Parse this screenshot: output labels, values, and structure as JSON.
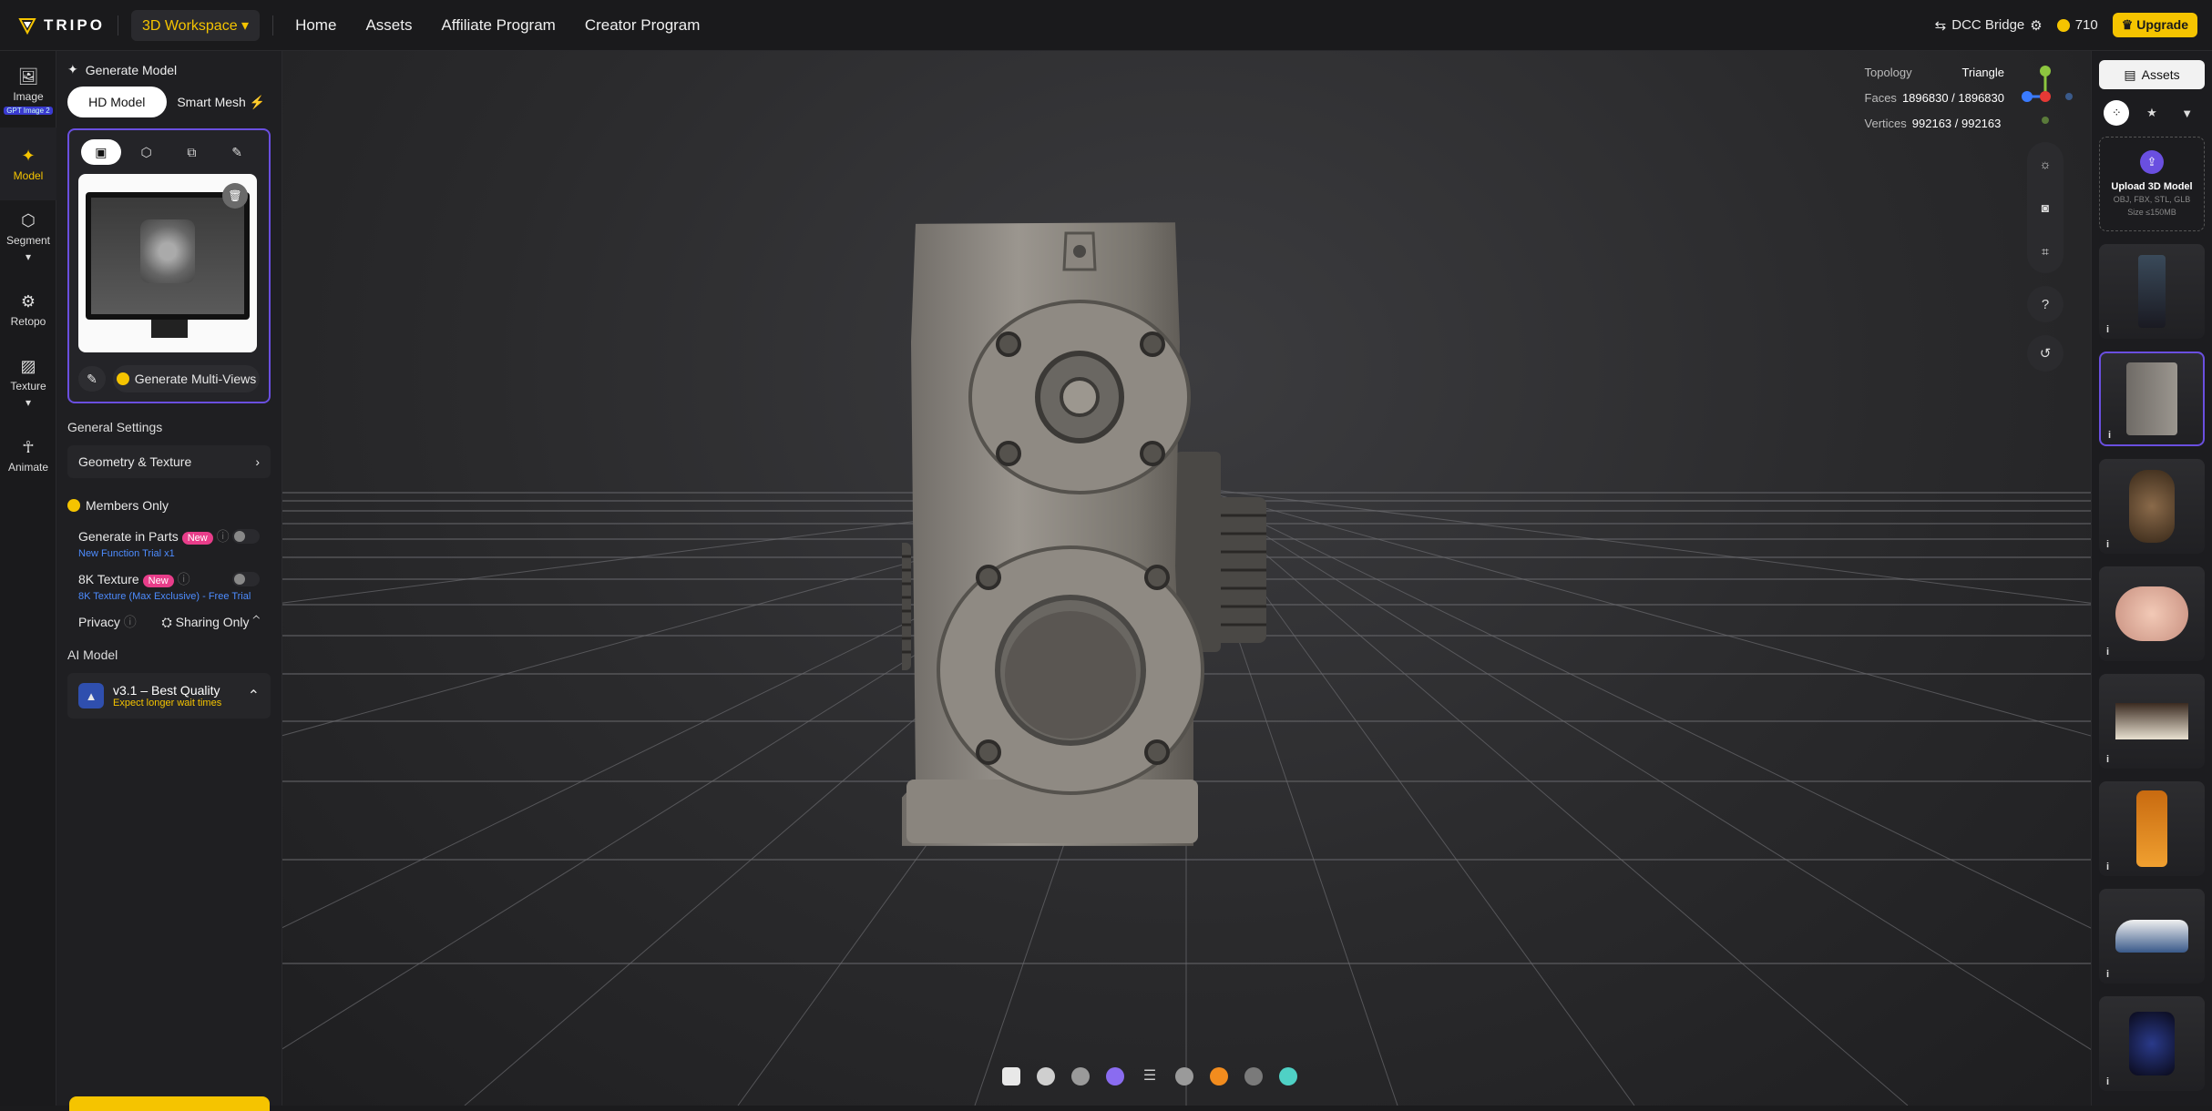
{
  "app": {
    "brand": "TRIPO",
    "workspace": "3D Workspace"
  },
  "nav": [
    "Home",
    "Assets",
    "Affiliate Program",
    "Creator Program"
  ],
  "top_right": {
    "dcc": "DCC Bridge",
    "credits": "710",
    "upgrade": "Upgrade"
  },
  "rail": [
    {
      "label": "Image",
      "badge": "GPT Image 2"
    },
    {
      "label": "Model"
    },
    {
      "label": "Segment"
    },
    {
      "label": "Retopo"
    },
    {
      "label": "Texture"
    },
    {
      "label": "Animate"
    }
  ],
  "panel": {
    "title": "Generate Model",
    "seg_hd": "HD Model",
    "seg_smart": "Smart Mesh",
    "gen_mv": "Generate Multi-Views",
    "general": "General Settings",
    "geo": "Geometry & Texture",
    "members": "Members Only",
    "parts": "Generate in Parts",
    "parts_sub": "New Function Trial x1",
    "tex8k": "8K Texture",
    "tex8k_sub": "8K Texture (Max Exclusive) - Free Trial",
    "new": "New",
    "privacy": "Privacy",
    "sharing": "Sharing Only",
    "ai_model": "AI Model",
    "model_name": "v3.1 – Best Quality",
    "model_sub": "Expect longer wait times"
  },
  "stats": {
    "topology_label": "Topology",
    "topology": "Triangle",
    "faces_label": "Faces",
    "faces": "1896830 / 1896830",
    "vertices_label": "Vertices",
    "vertices": "992163 / 992163"
  },
  "assets": {
    "tab": "Assets",
    "upload_title": "Upload 3D Model",
    "upload_formats": "OBJ, FBX, STL, GLB",
    "upload_size": "Size ≤150MB",
    "info": "i"
  },
  "colors": {
    "accent": "#f5c400",
    "purple": "#6a4fe0"
  }
}
